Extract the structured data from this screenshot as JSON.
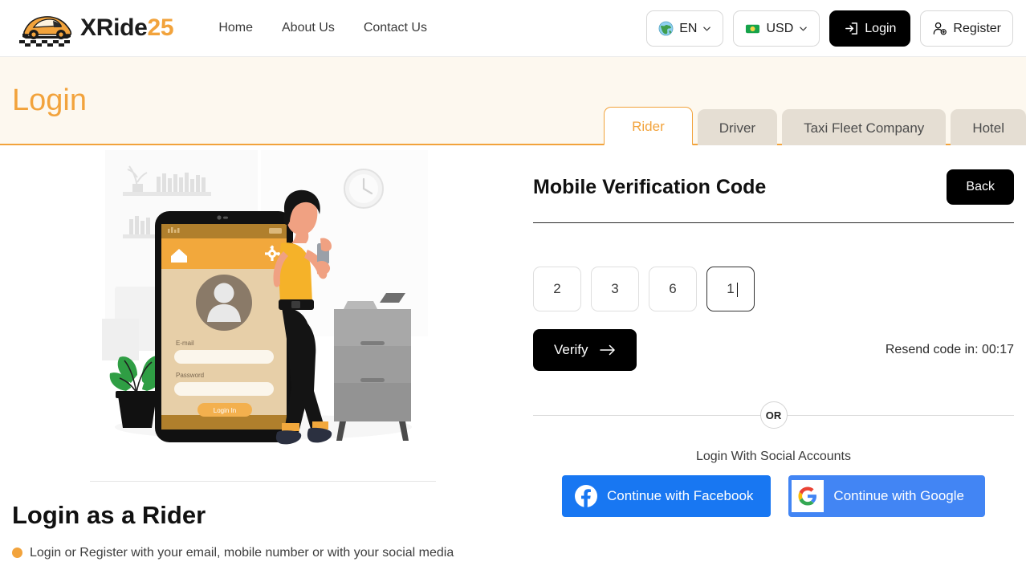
{
  "header": {
    "logo_text_main": "XRide",
    "logo_text_accent": "25",
    "logo_icon": "car-icon",
    "nav": [
      {
        "label": "Home"
      },
      {
        "label": "About Us"
      },
      {
        "label": "Contact Us"
      }
    ],
    "language": {
      "label": "EN",
      "icon": "globe-icon",
      "chevron": "chevron-down-icon"
    },
    "currency": {
      "label": "USD",
      "icon": "banknote-icon",
      "chevron": "chevron-down-icon"
    },
    "login": {
      "label": "Login",
      "icon": "login-arrow-icon"
    },
    "register": {
      "label": "Register",
      "icon": "user-plus-icon"
    }
  },
  "banner": {
    "title": "Login",
    "accent_color": "#f2a33c",
    "background_color": "#fdf8ef",
    "tabs": [
      {
        "label": "Rider",
        "active": true
      },
      {
        "label": "Driver",
        "active": false
      },
      {
        "label": "Taxi Fleet Company",
        "active": false
      },
      {
        "label": "Hotel",
        "active": false
      }
    ]
  },
  "illustration": {
    "name": "mobile-login-illustration",
    "phone_screen": {
      "email_label": "E-mail",
      "password_label": "Password",
      "button_label": "Login In",
      "home_icon": "home-icon",
      "settings_icon": "gear-icon",
      "avatar_icon": "user-avatar-icon"
    },
    "scene_items": [
      "wall-clock",
      "bookshelf",
      "potted-plant",
      "filing-cabinet",
      "woman-with-phone"
    ]
  },
  "left": {
    "heading": "Login as a Rider",
    "bullets": [
      {
        "text": "Login or Register with your email, mobile number or with your social media"
      }
    ]
  },
  "form": {
    "title": "Mobile Verification Code",
    "back_label": "Back",
    "otp": [
      {
        "value": "2",
        "focused": false
      },
      {
        "value": "3",
        "focused": false
      },
      {
        "value": "6",
        "focused": false
      },
      {
        "value": "1",
        "focused": true
      }
    ],
    "verify_label": "Verify",
    "verify_icon": "arrow-right-icon",
    "resend_text": "Resend code in: 00:17",
    "or_label": "OR",
    "social_heading": "Login With Social Accounts",
    "facebook": {
      "label": "Continue with Facebook",
      "icon": "facebook-icon",
      "color": "#1877f2"
    },
    "google": {
      "label": "Continue with Google",
      "icon": "google-icon",
      "color": "#4285f4"
    }
  }
}
